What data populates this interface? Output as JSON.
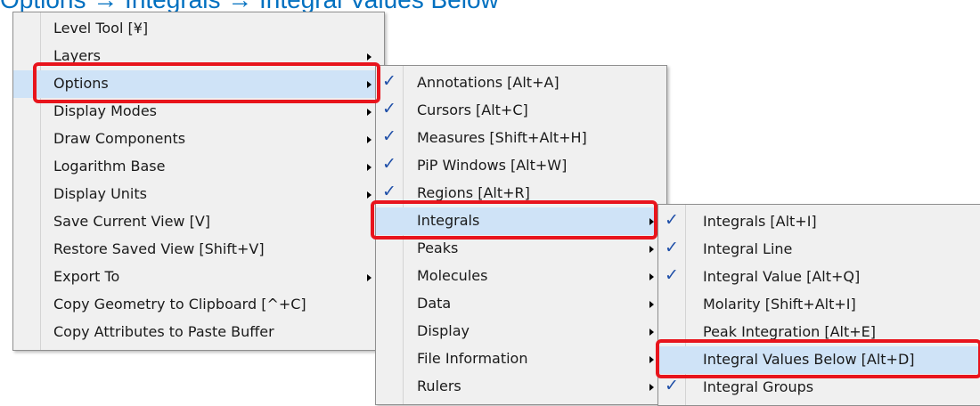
{
  "header": {
    "text": "Options → Integrals → Integral Values Below"
  },
  "colors": {
    "highlight": "#e8141c",
    "check": "#1f4fa8",
    "accent": "#0070c0"
  },
  "menu1": {
    "items": [
      {
        "label": "Level Tool [¥]",
        "submenu": false
      },
      {
        "label": "Layers",
        "submenu": true
      },
      {
        "label": "Options",
        "submenu": true,
        "highlighted": true
      },
      {
        "label": "Display Modes",
        "submenu": true
      },
      {
        "label": "Draw Components",
        "submenu": true
      },
      {
        "label": "Logarithm Base",
        "submenu": true
      },
      {
        "label": "Display Units",
        "submenu": true
      },
      {
        "label": "Save Current View [V]",
        "submenu": false
      },
      {
        "label": "Restore Saved View [Shift+V]",
        "submenu": false
      },
      {
        "label": "Export To",
        "submenu": true
      },
      {
        "label": "Copy Geometry to Clipboard [^+C]",
        "submenu": false
      },
      {
        "label": "Copy Attributes to Paste Buffer",
        "submenu": false
      }
    ]
  },
  "menu2": {
    "items": [
      {
        "label": "Annotations [Alt+A]",
        "checked": true,
        "submenu": false
      },
      {
        "label": "Cursors [Alt+C]",
        "checked": true,
        "submenu": false
      },
      {
        "label": "Measures [Shift+Alt+H]",
        "checked": true,
        "submenu": false
      },
      {
        "label": "PiP Windows [Alt+W]",
        "checked": true,
        "submenu": false
      },
      {
        "label": "Regions [Alt+R]",
        "checked": true,
        "submenu": false
      },
      {
        "label": "Integrals",
        "checked": false,
        "submenu": true,
        "highlighted": true
      },
      {
        "label": "Peaks",
        "checked": false,
        "submenu": true
      },
      {
        "label": "Molecules",
        "checked": false,
        "submenu": true
      },
      {
        "label": "Data",
        "checked": false,
        "submenu": true
      },
      {
        "label": "Display",
        "checked": false,
        "submenu": true
      },
      {
        "label": "File Information",
        "checked": false,
        "submenu": true
      },
      {
        "label": "Rulers",
        "checked": false,
        "submenu": true
      }
    ]
  },
  "menu3": {
    "items": [
      {
        "label": "Integrals [Alt+I]",
        "checked": true
      },
      {
        "label": "Integral Line",
        "checked": true
      },
      {
        "label": "Integral Value [Alt+Q]",
        "checked": true
      },
      {
        "label": "Molarity [Shift+Alt+I]",
        "checked": false
      },
      {
        "label": "Peak Integration [Alt+E]",
        "checked": false
      },
      {
        "label": "Integral Values Below [Alt+D]",
        "checked": false,
        "highlighted": true
      },
      {
        "label": "Integral Groups",
        "checked": true
      }
    ]
  },
  "check_glyph": "✓"
}
